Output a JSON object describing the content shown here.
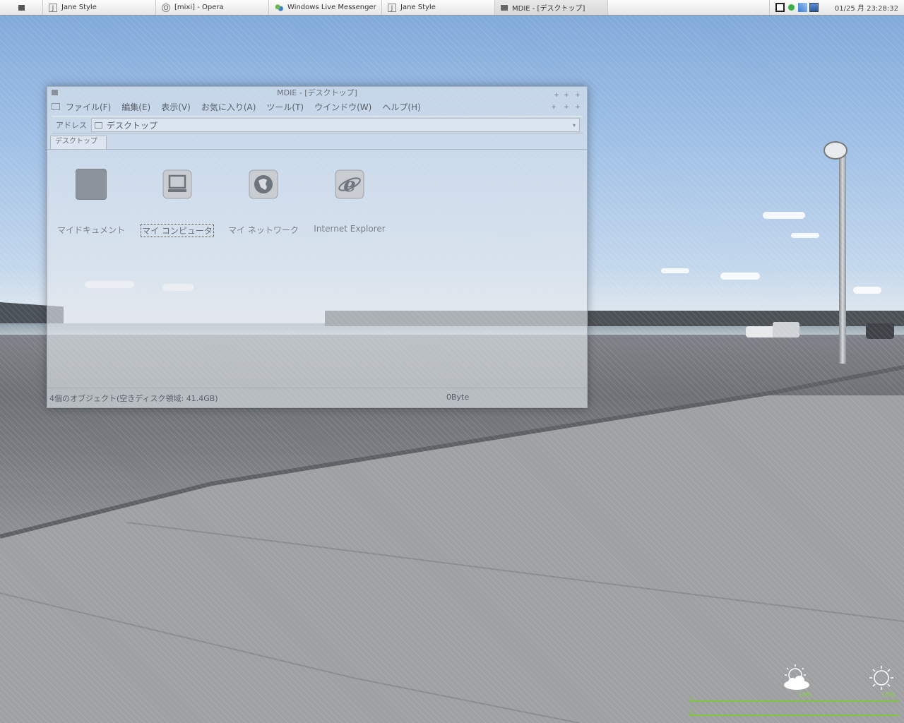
{
  "taskbar": {
    "items": [
      {
        "icon": "J",
        "label": "Jane Style"
      },
      {
        "icon": "O",
        "label": "[mixi] - Opera"
      },
      {
        "icon": "msn",
        "label": "Windows Live Messenger"
      },
      {
        "icon": "J",
        "label": "Jane Style"
      },
      {
        "icon": "win",
        "label": "MDIE - [デスクトップ]"
      }
    ],
    "clock": "01/25 月 23:28:32"
  },
  "window": {
    "title": "MDIE - [デスクトップ]",
    "menu": [
      "ファイル(F)",
      "編集(E)",
      "表示(V)",
      "お気に入り(A)",
      "ツール(T)",
      "ウインドウ(W)",
      "ヘルプ(H)"
    ],
    "address_label": "アドレス",
    "address_value": "デスクトップ",
    "tab": "デスクトップ",
    "icons": [
      {
        "label": "マイドキュメント",
        "icon": "documents-icon"
      },
      {
        "label": "マイ コンピュータ",
        "icon": "computer-icon"
      },
      {
        "label": "マイ ネットワーク",
        "icon": "network-icon"
      },
      {
        "label": "Internet Explorer",
        "icon": "ie-icon"
      }
    ],
    "status_left": "4個のオブジェクト(空きディスク領域: 41.4GB)",
    "status_right": "0Byte"
  },
  "gadget": {
    "left_percent": "10%",
    "right_percent": "10%",
    "bar1_label": "C:",
    "bar2_label": "G:",
    "bar_color": "#7fc63c"
  }
}
